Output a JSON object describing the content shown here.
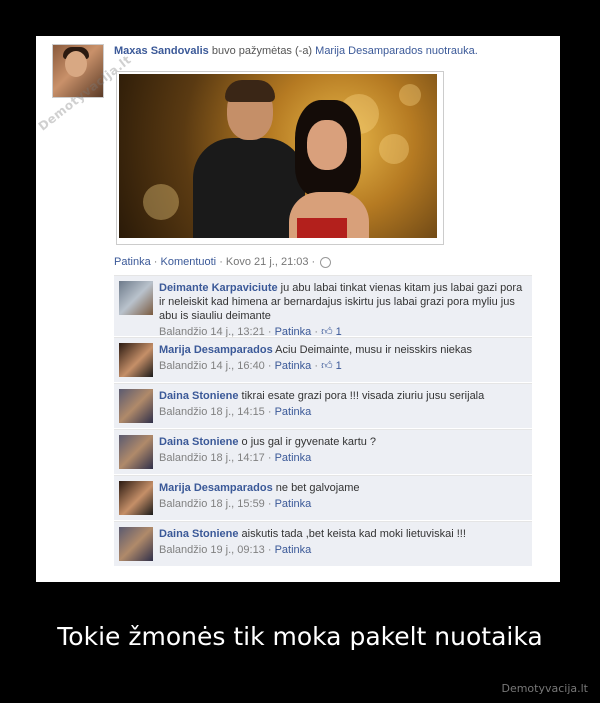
{
  "post": {
    "actor": "Maxas Sandovalis",
    "story_middle": " buvo pažymėtas (-a) ",
    "story_target": "Marija Desamparados nuotrauka.",
    "watermark": "Demotyvacija.lt",
    "actions": {
      "like": "Patinka",
      "comment": "Komentuoti",
      "separator": " · ",
      "time": "Kovo 21 j., 21:03"
    }
  },
  "comments": [
    {
      "name": "Deimante Karpaviciute",
      "text": " ju abu labai tinkat vienas kitam jus labai gazi pora ir neleiskit kad himena ar bernardajus iskirtu jus labai grazi pora myliu jus abu is siauliu deimante",
      "time": "Balandžio 14 j., 13:21",
      "like": "Patinka",
      "likes": "1",
      "avatar": "a1"
    },
    {
      "name": "Marija Desamparados",
      "text": " Aciu Deimainte, musu ir neisskirs niekas",
      "time": "Balandžio 14 j., 16:40",
      "like": "Patinka",
      "likes": "1",
      "avatar": "a2"
    },
    {
      "name": "Daina Stoniene",
      "text": " tikrai esate grazi pora !!! visada ziuriu jusu serijala",
      "time": "Balandžio 18 j., 14:15",
      "like": "Patinka",
      "likes": "",
      "avatar": "a3"
    },
    {
      "name": "Daina Stoniene",
      "text": " o jus gal ir gyvenate kartu ?",
      "time": "Balandžio 18 j., 14:17",
      "like": "Patinka",
      "likes": "",
      "avatar": "a3"
    },
    {
      "name": "Marija Desamparados",
      "text": " ne bet galvojame",
      "time": "Balandžio 18 j., 15:59",
      "like": "Patinka",
      "likes": "",
      "avatar": "a2"
    },
    {
      "name": "Daina Stoniene",
      "text": " aiskutis tada ,bet keista kad moki lietuviskai !!!",
      "time": "Balandžio 19 j., 09:13",
      "like": "Patinka",
      "likes": "",
      "avatar": "a3"
    }
  ],
  "caption": "Tokie žmonės tik moka pakelt nuotaika",
  "brand": "Demotyvacija.lt",
  "colors": {
    "link": "#3b5998",
    "comment_bg": "#edeff4",
    "background": "#000000"
  }
}
